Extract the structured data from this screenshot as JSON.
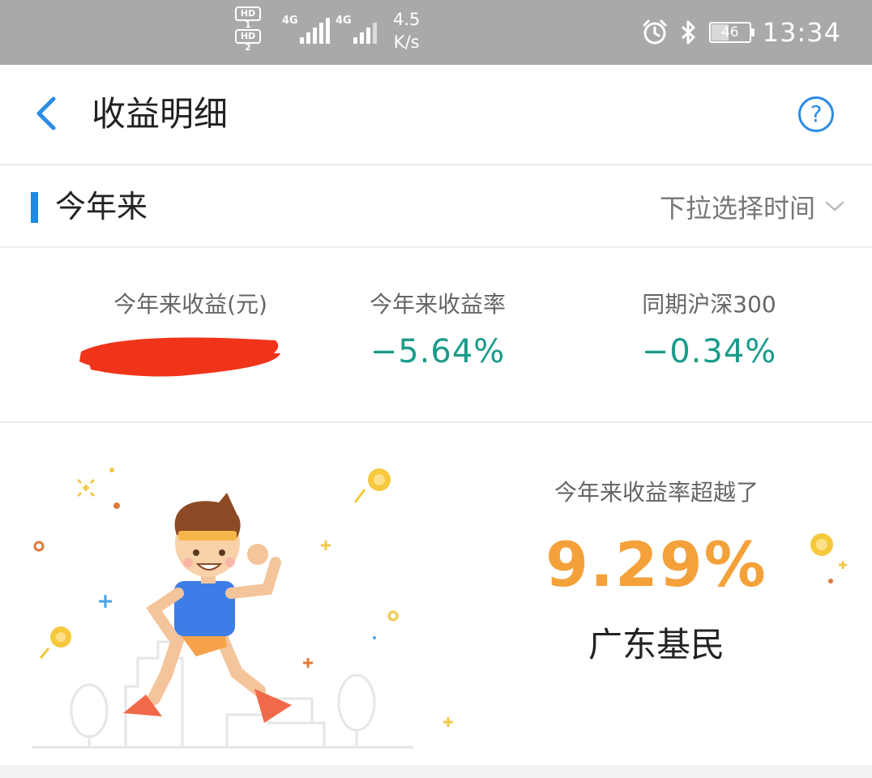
{
  "status_bar": {
    "sim1": "HD 1",
    "sim2": "HD 2",
    "net1": "4G",
    "net2": "4G",
    "speed_value": "4.5",
    "speed_unit": "K/s",
    "battery": "46",
    "time": "13:34",
    "icons": [
      "alarm-icon",
      "bluetooth-icon",
      "battery-icon"
    ]
  },
  "header": {
    "title": "收益明细",
    "back_icon": "chevron-left-icon",
    "help_icon": "question-circle-icon",
    "help_label": "?",
    "accent_color": "#2b8ce6"
  },
  "period": {
    "label": "今年来",
    "select_placeholder": "下拉选择时间",
    "select_icon": "chevron-down-icon"
  },
  "stats": [
    {
      "label": "今年来收益(元)",
      "value": "",
      "redacted": true
    },
    {
      "label": "今年来收益率",
      "value": "−5.64%"
    },
    {
      "label": "同期沪深300",
      "value": "−0.34%"
    }
  ],
  "beat": {
    "caption": "今年来收益率超越了",
    "percent": "9.29%",
    "region": "广东基民",
    "illustration": "running-man-illustration",
    "percent_color": "#f4a13a",
    "value_color": "#1a9c8a"
  }
}
